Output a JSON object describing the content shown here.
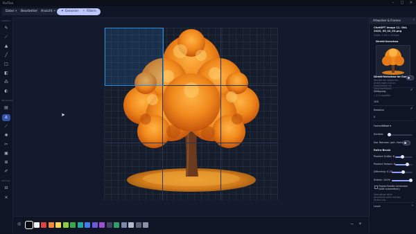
{
  "app": {
    "title": "PixlTree"
  },
  "window": {
    "minimize_icon": "minimize-icon",
    "maximize_icon": "maximize-icon",
    "close_icon": "close-icon"
  },
  "menus": [
    {
      "label": "Datei"
    },
    {
      "label": "Bearbeiten"
    },
    {
      "label": "Ansicht"
    }
  ],
  "actions": {
    "generate_label": "Generieren",
    "filter_label": "Filtern"
  },
  "left_toolbar": {
    "section_1": "Auswahl",
    "section_2": "Werkzeuge",
    "section_3": "Aktionen"
  },
  "right_panel": {
    "title": "Artworker & Frames",
    "file_name": "ChatGPT Image 11. Okt. 2025, 05_02_03.png",
    "file_size": "Größe: 1024 × 1024px",
    "preview_label": "Direkt-Vorschau",
    "canvas_preview_label": "Direkt-Vorschau im Canvas",
    "canvas_preview_desc": "Wendet die möglichen Änderungen live an. Deaktivieren für Vorschaumodus.",
    "saturation_label": "Sättigung",
    "saturation_hint": "= 1.0 ungefähr",
    "saturation_value": "100",
    "rotation_label": "Rotation",
    "rotation_value": "0",
    "swatch_label": "Farben",
    "swatch_select": "Mittel",
    "sharpness_label": "Schärfe",
    "only_frames_label": "Nur Rahmen (akt. Farbe)",
    "retro_brush_label": "Retro-Brush",
    "pixel_size_label": "Pixelart Größe: 8",
    "pixel_colors_label": "Pixelart Farben: 8",
    "dither_label": "Dithering: 0.20",
    "strength_label": "Stärke: 100%",
    "use_pixel_colors_label": "Projekt-Palette verwenden (statt automatisch)",
    "use_pixel_colors_desc": "Übergänge aktiv: Abstufung wählt auf den Farben aus.",
    "layers_label": "Layer",
    "pixel_size_pct": 0.4,
    "pixel_colors_pct": 0.7,
    "dither_pct": 0.55,
    "strength_pct": 1.0,
    "sharpness_pct": 0.08
  },
  "palette": {
    "swatches": [
      "#0b0d14",
      "#f2f2f2",
      "#e0443e",
      "#f28a3c",
      "#f6d35a",
      "#8fce3c",
      "#36a94a",
      "#25a7a0",
      "#3f7ee8",
      "#6b5ad8",
      "#9b4fd1",
      "#3a475e",
      "#2f9e6a",
      "#7a8aa8",
      "#b3b9c8",
      "#5a6378",
      "#8a93a8"
    ],
    "selected_index": 0,
    "colors": {
      "accent": "#3152a8",
      "selection": "#2b8de0",
      "pill": "#bcc8ff"
    }
  }
}
